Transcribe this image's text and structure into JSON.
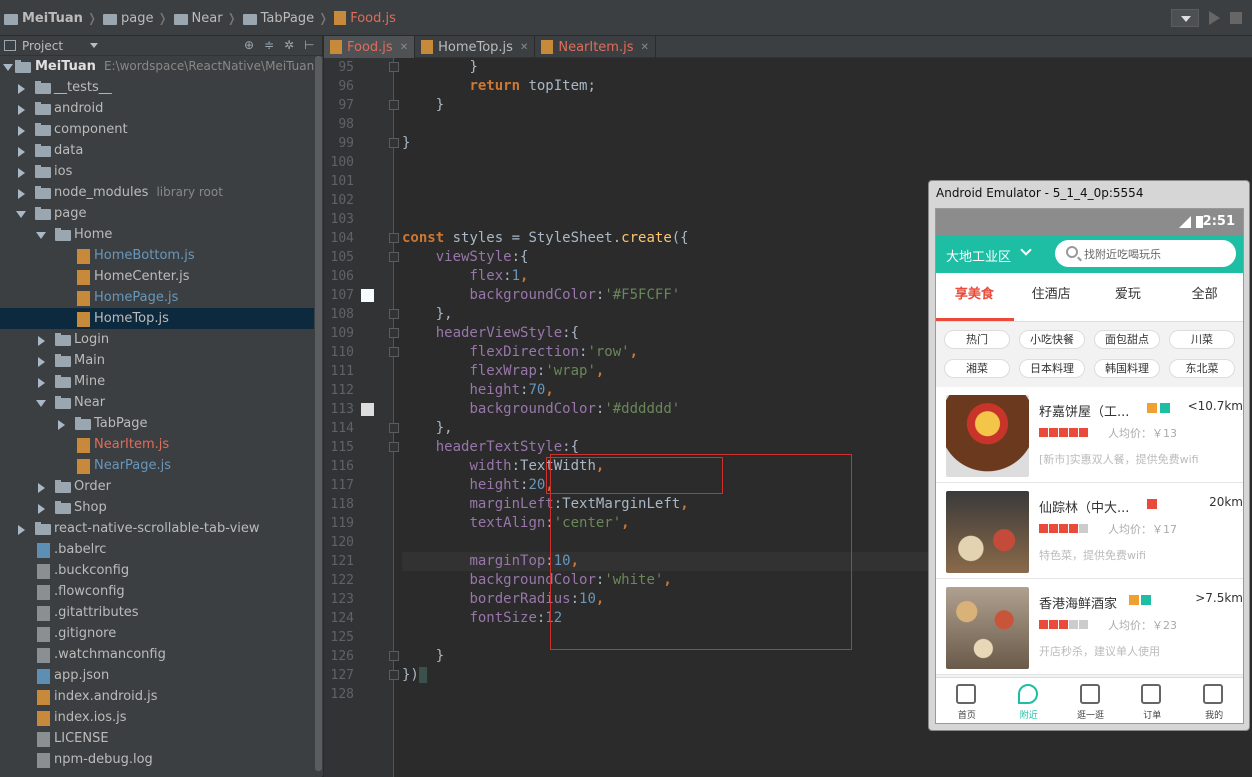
{
  "breadcrumbs": [
    {
      "label": "MeiTuan",
      "kind": "root"
    },
    {
      "label": "page",
      "kind": "folder"
    },
    {
      "label": "Near",
      "kind": "folder"
    },
    {
      "label": "TabPage",
      "kind": "folder"
    },
    {
      "label": "Food.js",
      "kind": "file"
    }
  ],
  "sidebar": {
    "title": "Project",
    "root_name": "MeiTuan",
    "root_path": "E:\\wordspace\\ReactNative\\MeiTuan",
    "library_hint": "library root",
    "items": [
      {
        "label": "__tests__"
      },
      {
        "label": "android"
      },
      {
        "label": "component"
      },
      {
        "label": "data"
      },
      {
        "label": "ios"
      },
      {
        "label": "node_modules"
      },
      {
        "label": "page"
      },
      {
        "label": "Home"
      },
      {
        "label": "HomeBottom.js"
      },
      {
        "label": "HomeCenter.js"
      },
      {
        "label": "HomePage.js"
      },
      {
        "label": "HomeTop.js"
      },
      {
        "label": "Login"
      },
      {
        "label": "Main"
      },
      {
        "label": "Mine"
      },
      {
        "label": "Near"
      },
      {
        "label": "TabPage"
      },
      {
        "label": "NearItem.js"
      },
      {
        "label": "NearPage.js"
      },
      {
        "label": "Order"
      },
      {
        "label": "Shop"
      },
      {
        "label": "react-native-scrollable-tab-view"
      },
      {
        "label": ".babelrc"
      },
      {
        "label": ".buckconfig"
      },
      {
        "label": ".flowconfig"
      },
      {
        "label": ".gitattributes"
      },
      {
        "label": ".gitignore"
      },
      {
        "label": ".watchmanconfig"
      },
      {
        "label": "app.json"
      },
      {
        "label": "index.android.js"
      },
      {
        "label": "index.ios.js"
      },
      {
        "label": "LICENSE"
      },
      {
        "label": "npm-debug.log"
      }
    ]
  },
  "editor_tabs": [
    {
      "label": "Food.js",
      "active": true
    },
    {
      "label": "HomeTop.js",
      "active": false
    },
    {
      "label": "NearItem.js",
      "active": false
    }
  ],
  "code": {
    "line_numbers": [
      "95",
      "96",
      "97",
      "98",
      "99",
      "100",
      "101",
      "102",
      "103",
      "104",
      "105",
      "106",
      "107",
      "108",
      "109",
      "110",
      "111",
      "112",
      "113",
      "114",
      "115",
      "116",
      "117",
      "118",
      "119",
      "120",
      "121",
      "122",
      "123",
      "124",
      "125",
      "126",
      "127",
      "128"
    ],
    "t": {
      "close_brace": "}",
      "return_kw": "return",
      "top_item": "topItem;",
      "const_kw": "const",
      "styles_decl": "styles = StyleSheet.",
      "create": "create",
      "open_paren": "({",
      "view_style": "viewStyle",
      "header_view_style": "headerViewStyle",
      "header_text_style": "headerTextStyle",
      "open_obj": ":{",
      "flex": "flex",
      "flex_val": "1",
      "bg_color": "backgroundColor",
      "bg_val1": "'#F5FCFF'",
      "bg_val2": "'#dddddd'",
      "bg_val3": "'white'",
      "close_obj": "},",
      "flex_dir": "flexDirection",
      "flex_dir_val": "'row'",
      "flex_wrap": "flexWrap",
      "flex_wrap_val": "'wrap'",
      "height": "height",
      "height_val1": "70",
      "height_val2": "20",
      "width": "width",
      "width_val": "TextWidth",
      "margin_left": "marginLeft",
      "margin_left_val": "TextMarginLeft",
      "text_align": "textAlign",
      "text_align_val": "'center'",
      "margin_top": "marginTop",
      "margin_top_val": "10",
      "border_radius": "borderRadius",
      "border_radius_val": "10",
      "font_size": "fontSize",
      "font_size_val": "12",
      "close_all": "})"
    },
    "color_swatches": [
      "#F5FCFF",
      "#dddddd"
    ]
  },
  "emulator": {
    "title": "Android Emulator - 5_1_4_0p:5554",
    "time": "2:51",
    "city": "大地工业区",
    "search_placeholder": "找附近吃喝玩乐",
    "tabs": [
      "享美食",
      "住酒店",
      "爱玩",
      "全部"
    ],
    "chips_row1": [
      "热门",
      "小吃快餐",
      "面包甜点",
      "川菜"
    ],
    "chips_row2": [
      "湘菜",
      "日本料理",
      "韩国料理",
      "东北菜"
    ],
    "items": [
      {
        "name": "籽嘉饼屋（工...",
        "distance": "<10.7km",
        "stars": 5,
        "avg": "人均价：￥13",
        "desc": "[新市]实惠双人餐，提供免费wifi"
      },
      {
        "name": "仙踪林（中大...",
        "distance": "20km",
        "stars": 4,
        "avg": "人均价：￥17",
        "desc": "特色菜，提供免费wifi"
      },
      {
        "name": "香港海鲜酒家",
        "distance": ">7.5km",
        "stars": 3,
        "avg": "人均价：￥23",
        "desc": "开店秒杀，建议单人使用"
      }
    ],
    "bottom_tabs": [
      "首页",
      "附近",
      "逛一逛",
      "订单",
      "我的"
    ],
    "accent": "#1ebea5",
    "red": "#e94a3a"
  }
}
